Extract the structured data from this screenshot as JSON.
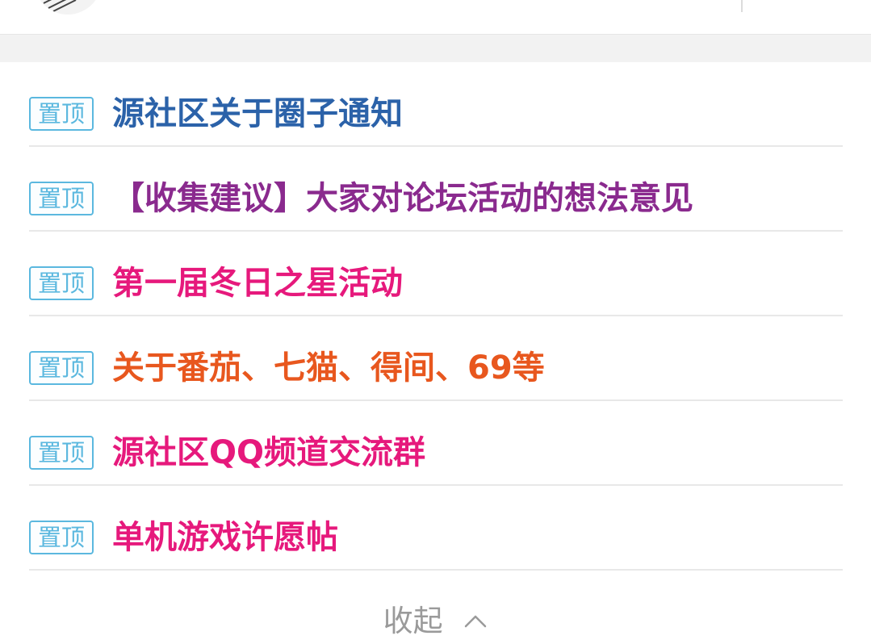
{
  "colors": {
    "badge": "#5bb8df",
    "collapse_text": "#9a9a9a",
    "divider": "#e8e8e8",
    "band": "#f2f2f2"
  },
  "pinned": [
    {
      "badge": "置顶",
      "title": "源社区关于圈子通知",
      "color": "#2b62a9"
    },
    {
      "badge": "置顶",
      "title": "【收集建议】大家对论坛活动的想法意见",
      "color": "#8a2a8e"
    },
    {
      "badge": "置顶",
      "title": "第一届冬日之星活动",
      "color": "#e6197c"
    },
    {
      "badge": "置顶",
      "title": "关于番茄、七猫、得间、69等",
      "color": "#e8571e"
    },
    {
      "badge": "置顶",
      "title": "源社区QQ频道交流群",
      "color": "#e6197c"
    },
    {
      "badge": "置顶",
      "title": "单机游戏许愿帖",
      "color": "#e6197c"
    }
  ],
  "collapse": {
    "label": "收起",
    "icon": "chevron-up-icon"
  }
}
